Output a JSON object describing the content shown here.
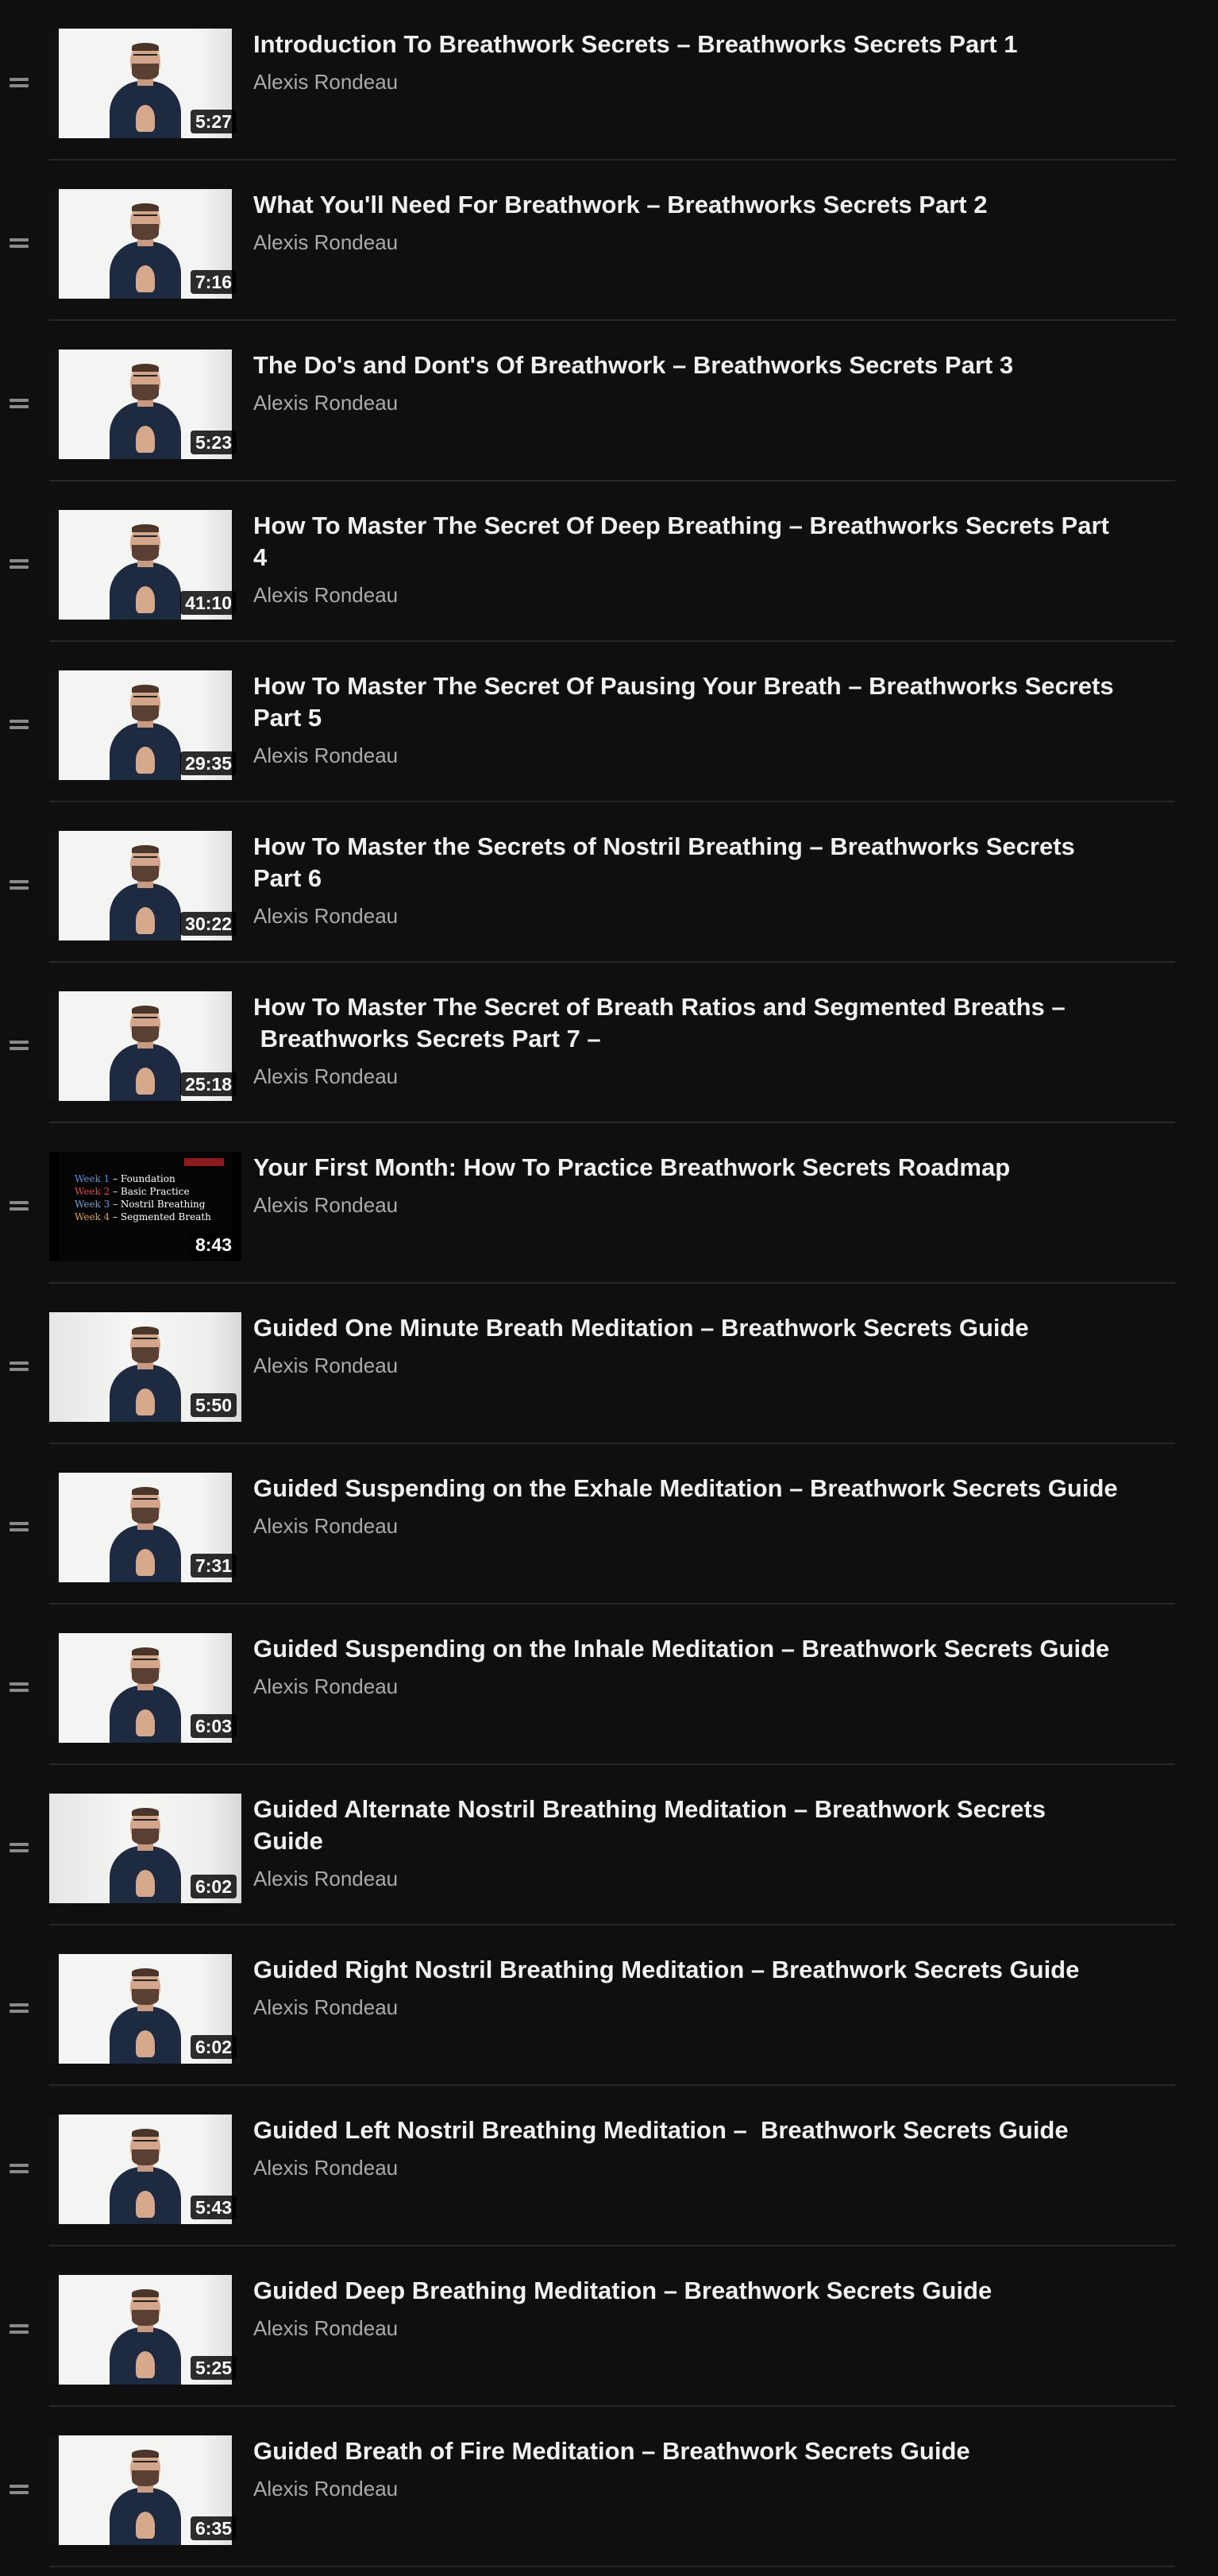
{
  "playlist": {
    "items": [
      {
        "title": "Introduction To Breathwork Secrets – Breathworks Secrets Part 1",
        "channel": "Alexis Rondeau",
        "duration": "5:27",
        "thumbnail": "presenter"
      },
      {
        "title": "What You'll Need For Breathwork – Breathworks Secrets Part 2",
        "channel": "Alexis Rondeau",
        "duration": "7:16",
        "thumbnail": "presenter"
      },
      {
        "title": "The Do's and Dont's Of Breathwork – Breathworks Secrets Part 3",
        "channel": "Alexis Rondeau",
        "duration": "5:23",
        "thumbnail": "presenter"
      },
      {
        "title": "How To Master The Secret Of Deep Breathing – Breathworks Secrets Part 4",
        "channel": "Alexis Rondeau",
        "duration": "41:10",
        "thumbnail": "presenter"
      },
      {
        "title": "How To Master The Secret Of Pausing Your Breath – Breathworks Secrets Part 5",
        "channel": "Alexis Rondeau",
        "duration": "29:35",
        "thumbnail": "presenter"
      },
      {
        "title": "How To Master the Secrets of Nostril Breathing – Breathworks Secrets Part 6",
        "channel": "Alexis Rondeau",
        "duration": "30:22",
        "thumbnail": "presenter"
      },
      {
        "title": "How To Master The Secret of Breath Ratios and Segmented Breaths – \n Breathworks Secrets Part 7 –",
        "channel": "Alexis Rondeau",
        "duration": "25:18",
        "thumbnail": "presenter"
      },
      {
        "title": "Your First Month: How To Practice Breathwork Secrets Roadmap",
        "channel": "Alexis Rondeau",
        "duration": "8:43",
        "thumbnail": "slide",
        "slide_lines": [
          "Week 1 – Foundation",
          "Week 2 – Basic Practice",
          "Week 3 – Nostril Breathing",
          "Week 4 – Segmented Breath"
        ]
      },
      {
        "title": "Guided One Minute Breath Meditation – Breathwork Secrets Guide",
        "channel": "Alexis Rondeau",
        "duration": "5:50",
        "thumbnail": "presenter-wide"
      },
      {
        "title": "Guided Suspending on the Exhale Meditation – Breathwork Secrets Guide",
        "channel": "Alexis Rondeau",
        "duration": "7:31",
        "thumbnail": "presenter"
      },
      {
        "title": "Guided Suspending on the Inhale Meditation – Breathwork Secrets Guide",
        "channel": "Alexis Rondeau",
        "duration": "6:03",
        "thumbnail": "presenter"
      },
      {
        "title": "Guided Alternate Nostril Breathing Meditation – Breathwork Secrets Guide",
        "channel": "Alexis Rondeau",
        "duration": "6:02",
        "thumbnail": "presenter-wide"
      },
      {
        "title": "Guided Right Nostril Breathing Meditation – Breathwork Secrets Guide",
        "channel": "Alexis Rondeau",
        "duration": "6:02",
        "thumbnail": "presenter"
      },
      {
        "title": "Guided Left Nostril Breathing Meditation –  Breathwork Secrets Guide",
        "channel": "Alexis Rondeau",
        "duration": "5:43",
        "thumbnail": "presenter"
      },
      {
        "title": "Guided Deep Breathing Meditation – Breathwork Secrets Guide",
        "channel": "Alexis Rondeau",
        "duration": "5:25",
        "thumbnail": "presenter"
      },
      {
        "title": "Guided Breath of Fire Meditation – Breathwork Secrets Guide",
        "channel": "Alexis Rondeau",
        "duration": "6:35",
        "thumbnail": "presenter"
      }
    ]
  },
  "colors": {
    "background": "#0f0f0f",
    "title": "#f1f1f1",
    "channel": "#aaaaaa",
    "divider": "#272727",
    "drag_handle": "#8a8a8a"
  }
}
